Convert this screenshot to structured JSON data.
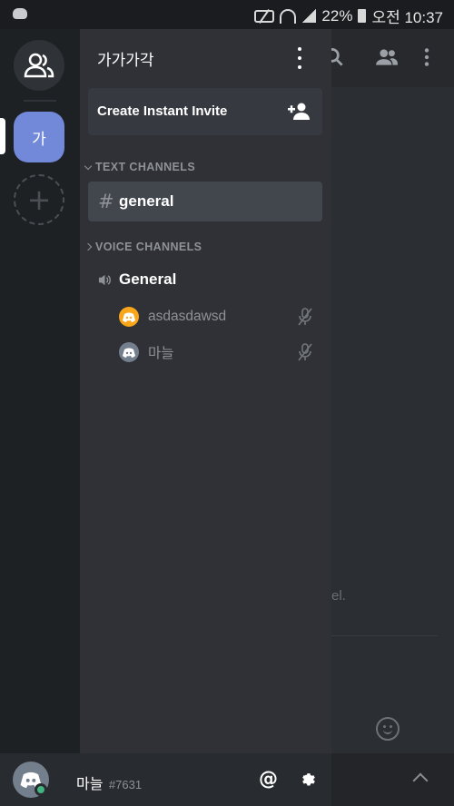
{
  "status_bar": {
    "battery": "22%",
    "time": "오전 10:37"
  },
  "rail": {
    "guild_initial": "가",
    "add_symbol": "+"
  },
  "server": {
    "name": "가가가각"
  },
  "invite": {
    "label": "Create Instant Invite"
  },
  "categories": {
    "text": "TEXT CHANNELS",
    "voice": "VOICE CHANNELS"
  },
  "text_channel": {
    "symbol": "#",
    "name": "general"
  },
  "voice_channel": {
    "name": "General",
    "users": [
      {
        "name": "asdasdawsd",
        "avatar_color": "#faa61a"
      },
      {
        "name": "마늘",
        "avatar_color": "#747f8d"
      }
    ]
  },
  "chat_fragment": "el.",
  "user": {
    "name": "마늘",
    "discriminator": "#7631",
    "status_color": "#43b581",
    "mention_symbol": "@"
  },
  "colors": {
    "accent": "#7289da",
    "drawer": "#2f3136",
    "rail": "#1e2124"
  }
}
